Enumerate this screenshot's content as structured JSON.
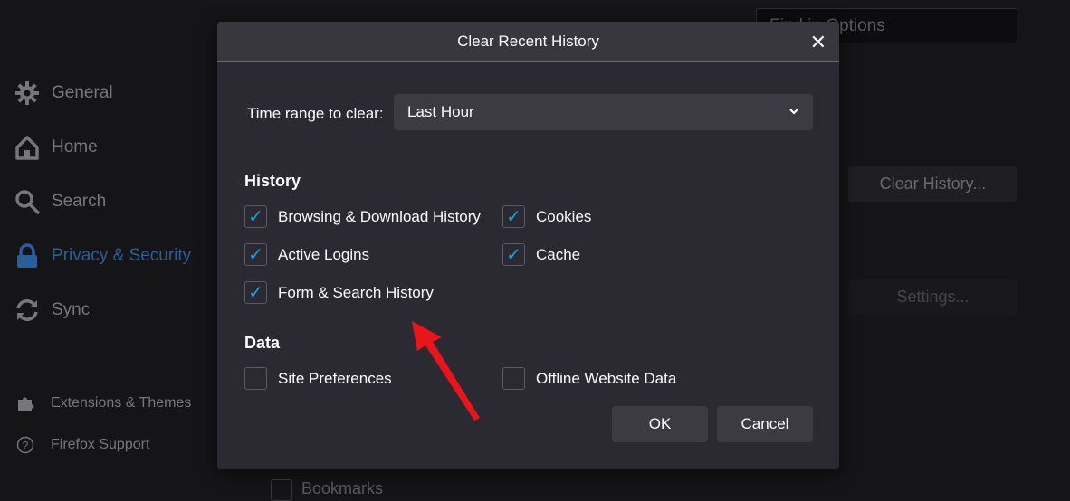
{
  "sidebar": {
    "items": [
      {
        "label": "General",
        "icon": "gear-icon"
      },
      {
        "label": "Home",
        "icon": "home-icon"
      },
      {
        "label": "Search",
        "icon": "search-icon"
      },
      {
        "label": "Privacy & Security",
        "icon": "lock-icon",
        "active": true
      },
      {
        "label": "Sync",
        "icon": "sync-icon"
      }
    ],
    "footer": [
      {
        "label": "Extensions & Themes",
        "icon": "puzzle-icon"
      },
      {
        "label": "Firefox Support",
        "icon": "help-icon"
      }
    ]
  },
  "background": {
    "search_placeholder": "Find in Options",
    "clear_history": "Clear History...",
    "settings": "Settings...",
    "bookmarks": "Bookmarks"
  },
  "dialog": {
    "title": "Clear Recent History",
    "time_range_label": "Time range to clear:",
    "time_range_value": "Last Hour",
    "history_heading": "History",
    "history": [
      {
        "label": "Browsing & Download History",
        "checked": true
      },
      {
        "label": "Cookies",
        "checked": true
      },
      {
        "label": "Active Logins",
        "checked": true
      },
      {
        "label": "Cache",
        "checked": true
      },
      {
        "label": "Form & Search History",
        "checked": true
      }
    ],
    "data_heading": "Data",
    "data": [
      {
        "label": "Site Preferences",
        "checked": false
      },
      {
        "label": "Offline Website Data",
        "checked": false
      }
    ],
    "ok": "OK",
    "cancel": "Cancel"
  },
  "colors": {
    "accent": "#1e9ce0",
    "active_nav": "#2a5e9a",
    "annotation_arrow": "#e8151b"
  }
}
